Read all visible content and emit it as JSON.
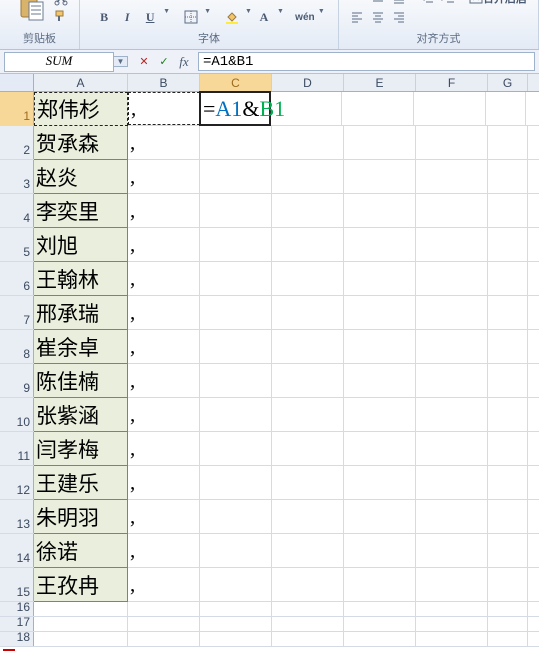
{
  "ribbon": {
    "clipboard": {
      "label": "剪贴板"
    },
    "font": {
      "label": "字体",
      "bold": "B",
      "italic": "I",
      "underline": "U"
    },
    "alignment": {
      "label": "对齐方式",
      "merge": "合并后居"
    }
  },
  "namebox": {
    "value": "SUM"
  },
  "formula_buttons": {
    "cancel": "✕",
    "enter": "✓",
    "fx": "fx"
  },
  "formula": {
    "text": "=A1&B1"
  },
  "columns": [
    "A",
    "B",
    "C",
    "D",
    "E",
    "F",
    "G"
  ],
  "rows": [
    {
      "n": "1",
      "a": "郑伟杉",
      "b": ",",
      "c_display": "=A1&B1"
    },
    {
      "n": "2",
      "a": "贺承森",
      "b": ","
    },
    {
      "n": "3",
      "a": "赵炎",
      "b": ","
    },
    {
      "n": "4",
      "a": "李奕里",
      "b": ","
    },
    {
      "n": "5",
      "a": "刘旭",
      "b": ","
    },
    {
      "n": "6",
      "a": "王翰林",
      "b": ","
    },
    {
      "n": "7",
      "a": "邢承瑞",
      "b": ","
    },
    {
      "n": "8",
      "a": "崔余卓",
      "b": ","
    },
    {
      "n": "9",
      "a": "陈佳楠",
      "b": ","
    },
    {
      "n": "10",
      "a": "张紫涵",
      "b": ","
    },
    {
      "n": "11",
      "a": "闫孝梅",
      "b": ","
    },
    {
      "n": "12",
      "a": "王建乐",
      "b": ","
    },
    {
      "n": "13",
      "a": "朱明羽",
      "b": ","
    },
    {
      "n": "14",
      "a": "徐诺",
      "b": ","
    },
    {
      "n": "15",
      "a": "王孜冉",
      "b": ","
    },
    {
      "n": "16",
      "a": "",
      "b": ""
    },
    {
      "n": "17",
      "a": "",
      "b": ""
    },
    {
      "n": "18",
      "a": "",
      "b": ""
    }
  ],
  "editing": {
    "cell": "C1",
    "formula_parts": {
      "eq": "=",
      "ref1": "A1",
      "amp": "&",
      "ref2": "B1"
    }
  }
}
